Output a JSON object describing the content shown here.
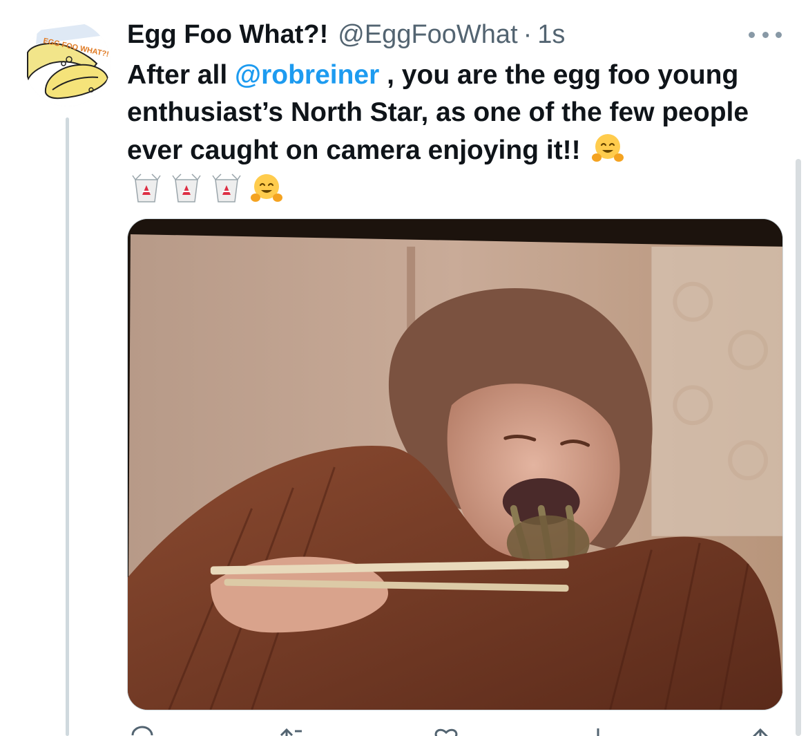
{
  "tweet": {
    "author": {
      "display_name": "Egg Foo What?!",
      "handle": "@EggFooWhat",
      "separator": "·",
      "time": "1s",
      "avatar_text": "EGG FOO WHAT?!"
    },
    "text": {
      "part1": "After all ",
      "mention": "@robreiner",
      "part2": " , you are the egg foo young enthusiast’s North Star, as one of the few people ever caught on camera enjoying it!!"
    },
    "emojis": {
      "inline": "hugging-face-emoji",
      "row": [
        "takeout-box-emoji",
        "takeout-box-emoji",
        "takeout-box-emoji",
        "hugging-face-emoji"
      ]
    },
    "media": {
      "description_icon": "photo"
    },
    "actions": [
      "reply-icon",
      "retweet-icon",
      "like-icon",
      "views-icon",
      "share-icon"
    ]
  },
  "colors": {
    "text": "#0f1419",
    "secondary": "#536471",
    "link": "#1d9bf0",
    "thread_line": "#cfd9de"
  }
}
